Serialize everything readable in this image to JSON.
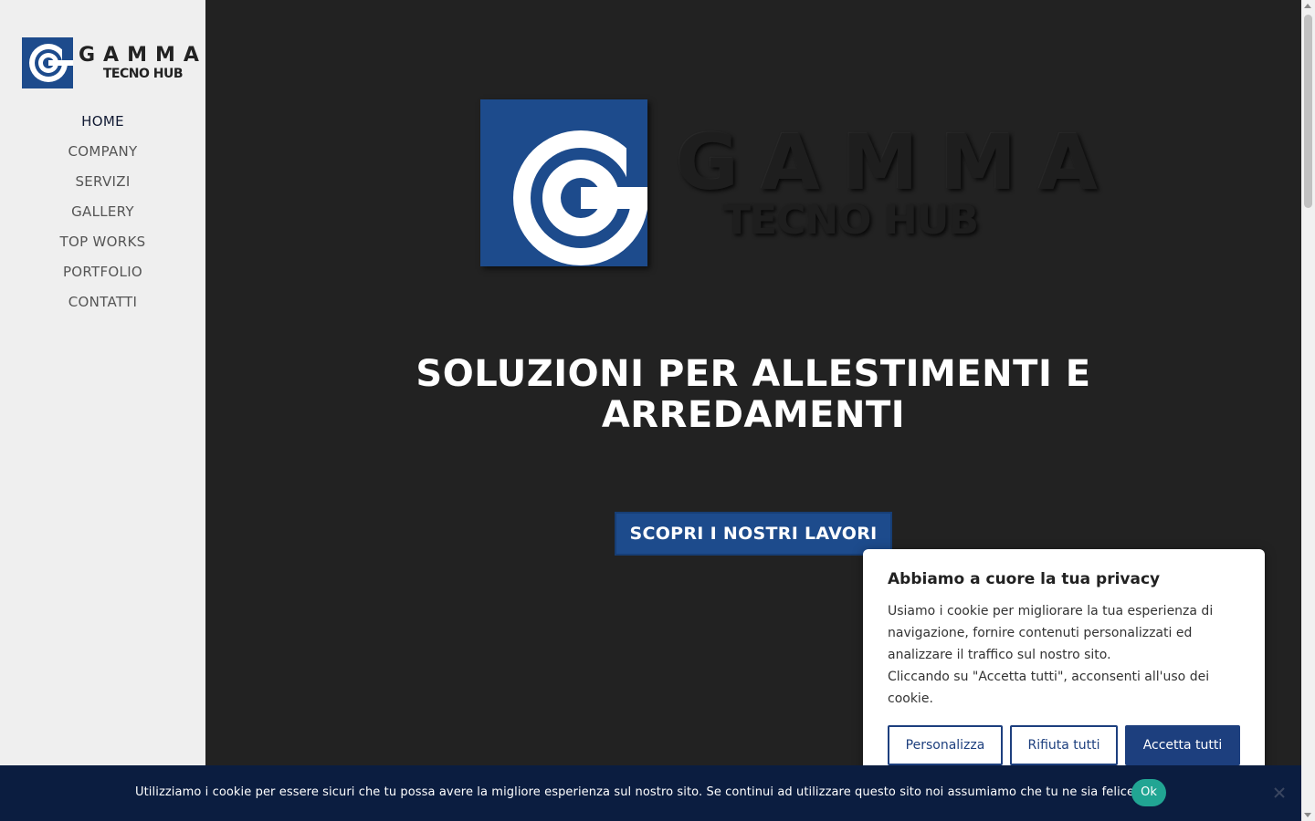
{
  "sidebar": {
    "logo": {
      "line1": "GAMMA",
      "line2": "TECNO HUB"
    },
    "nav": [
      {
        "label": "HOME",
        "active": true
      },
      {
        "label": "COMPANY"
      },
      {
        "label": "SERVIZI"
      },
      {
        "label": "GALLERY"
      },
      {
        "label": "TOP WORKS"
      },
      {
        "label": "PORTFOLIO"
      },
      {
        "label": "CONTATTI"
      }
    ]
  },
  "hero": {
    "logo": {
      "line1": "GAMMA",
      "line2": "TECNO HUB"
    },
    "headline_line1": "SOLUZIONI PER ALLESTIMENTI E",
    "headline_line2": "ARREDAMENTI",
    "cta_label": "SCOPRI I NOSTRI LAVORI"
  },
  "privacy_modal": {
    "title": "Abbiamo a cuore la tua privacy",
    "body": "Usiamo i cookie per migliorare la tua esperienza di navigazione, fornire contenuti personalizzati ed analizzare il traffico sul nostro sito.",
    "body2": "Cliccando su \"Accetta tutti\", acconsenti all'uso dei cookie.",
    "buttons": {
      "customize": "Personalizza",
      "reject": "Rifiuta tutti",
      "accept": "Accetta tutti"
    }
  },
  "cookie_bar": {
    "message": "Utilizziamo i cookie per essere sicuri che tu possa avere la migliore esperienza sul nostro sito. Se continui ad utilizzare questo sito noi assumiamo che tu ne sia felice.",
    "ok_label": "Ok",
    "close_icon": "close-icon"
  },
  "colors": {
    "brand_blue": "#1d4b8c",
    "page_bg": "#222222",
    "sidebar_bg": "#efefef",
    "cookie_bar_bg": "#0b1d40",
    "ok_green": "#21a593"
  }
}
